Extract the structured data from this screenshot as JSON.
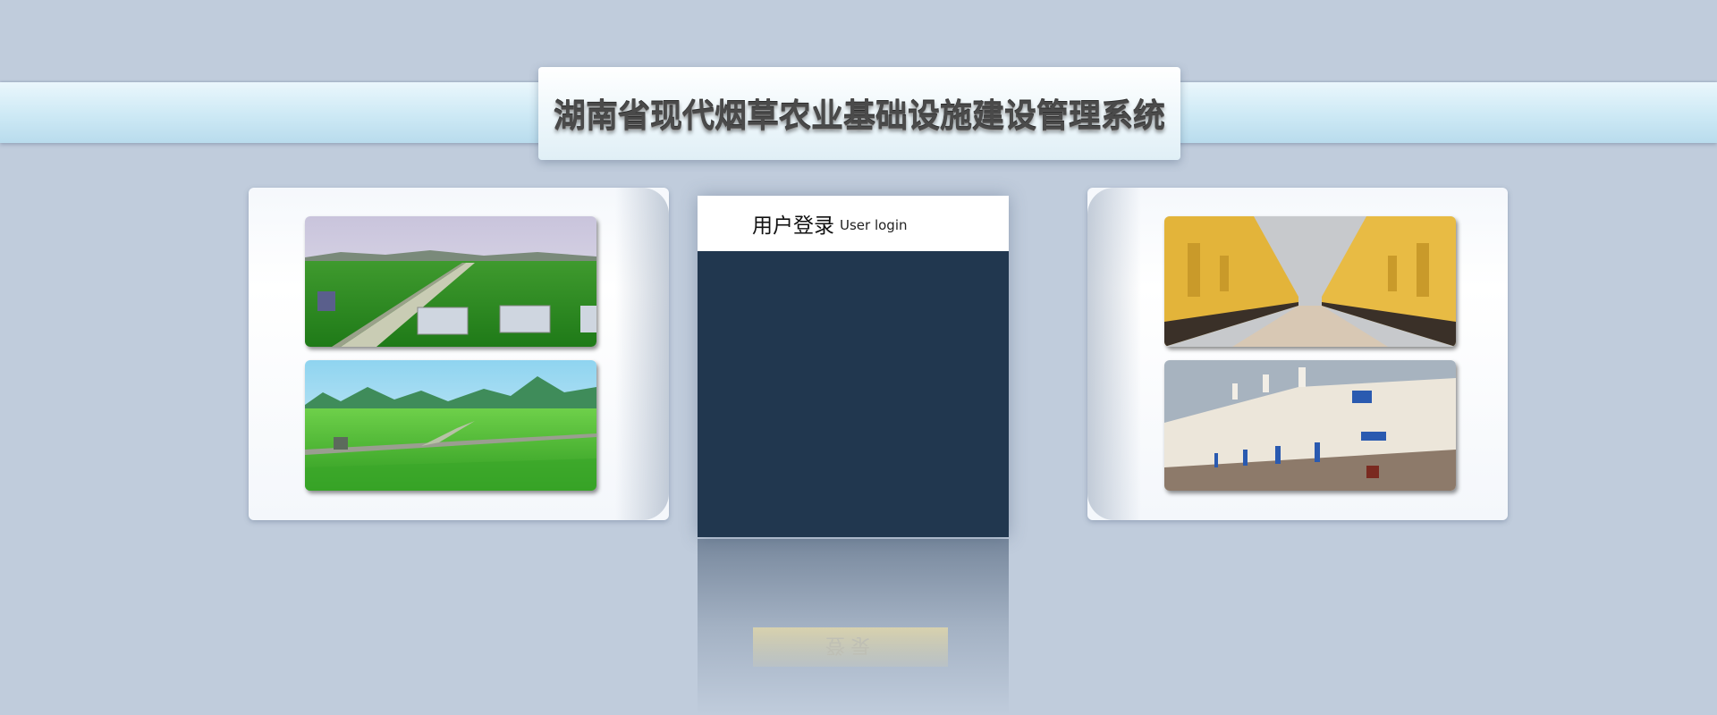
{
  "header": {
    "system_title": "湖南省现代烟草农业基础设施建设管理系统"
  },
  "login": {
    "title": "用户登录",
    "subtitle": "User login",
    "button_reflection": "登录"
  },
  "colors": {
    "page_bg": "#c0ccdc",
    "band": "#cde9f5",
    "login_body": "#21374f",
    "login_header": "#ffffff"
  },
  "images": [
    {
      "name": "tobacco-field-road-photo"
    },
    {
      "name": "tobacco-field-mountains-photo"
    },
    {
      "name": "yellow-curing-barns-photo"
    },
    {
      "name": "white-curing-barns-photo"
    }
  ]
}
